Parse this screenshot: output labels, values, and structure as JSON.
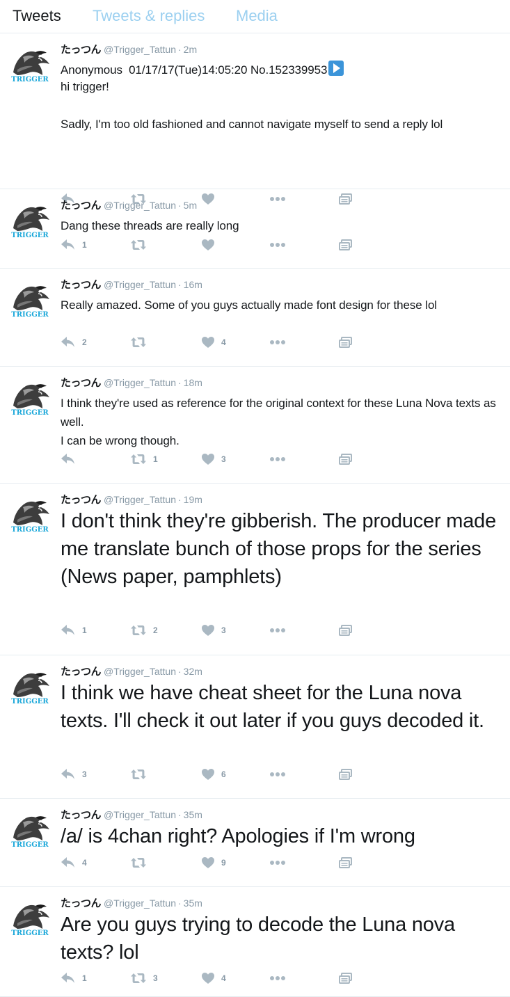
{
  "tabs": [
    {
      "label": "Tweets"
    },
    {
      "label": "Tweets & replies"
    },
    {
      "label": "Media"
    }
  ],
  "account": {
    "name": "たっつん",
    "handle": "@Trigger_Tattun",
    "avatar_text": "TRIGGER"
  },
  "colors": {
    "accent": "#1da1f2",
    "inactive_tab": "#9cd0f0",
    "muted": "#8899a6",
    "icon": "#aab8c2",
    "avatar_text": "#1aa7d9"
  },
  "tweets": [
    {
      "time": "2m",
      "text": "Anonymous  01/17/17(Tue)14:05:20 No.152339953",
      "text2": "hi trigger!\n\nSadly, I'm too old fashioned and cannot navigate myself to send a reply lol",
      "reply_count": "",
      "retweet_count": "",
      "like_count": ""
    },
    {
      "time": "5m",
      "text": "Dang these threads are really long",
      "reply_count": "1",
      "retweet_count": "",
      "like_count": ""
    },
    {
      "time": "16m",
      "text": "Really amazed. Some of you guys actually made font design for these lol",
      "reply_count": "2",
      "retweet_count": "",
      "like_count": "4"
    },
    {
      "time": "18m",
      "text": "I think they're used as reference for the original context for these Luna Nova texts as well.\nI can be wrong though.",
      "reply_count": "",
      "retweet_count": "1",
      "like_count": "3"
    },
    {
      "time": "19m",
      "text": "I don't think they're gibberish. The producer made me translate bunch of those props for the series (News paper, pamphlets)",
      "reply_count": "1",
      "retweet_count": "2",
      "like_count": "3"
    },
    {
      "time": "32m",
      "text": "I think we have cheat sheet for the Luna nova texts. I'll check it out later if you guys decoded it.",
      "reply_count": "3",
      "retweet_count": "",
      "like_count": "6"
    },
    {
      "time": "35m",
      "text": "/a/ is 4chan right? Apologies if I'm wrong",
      "reply_count": "4",
      "retweet_count": "",
      "like_count": "9"
    },
    {
      "time": "35m",
      "text": "Are you guys trying to decode the Luna nova texts? lol",
      "reply_count": "1",
      "retweet_count": "3",
      "like_count": "4"
    }
  ]
}
